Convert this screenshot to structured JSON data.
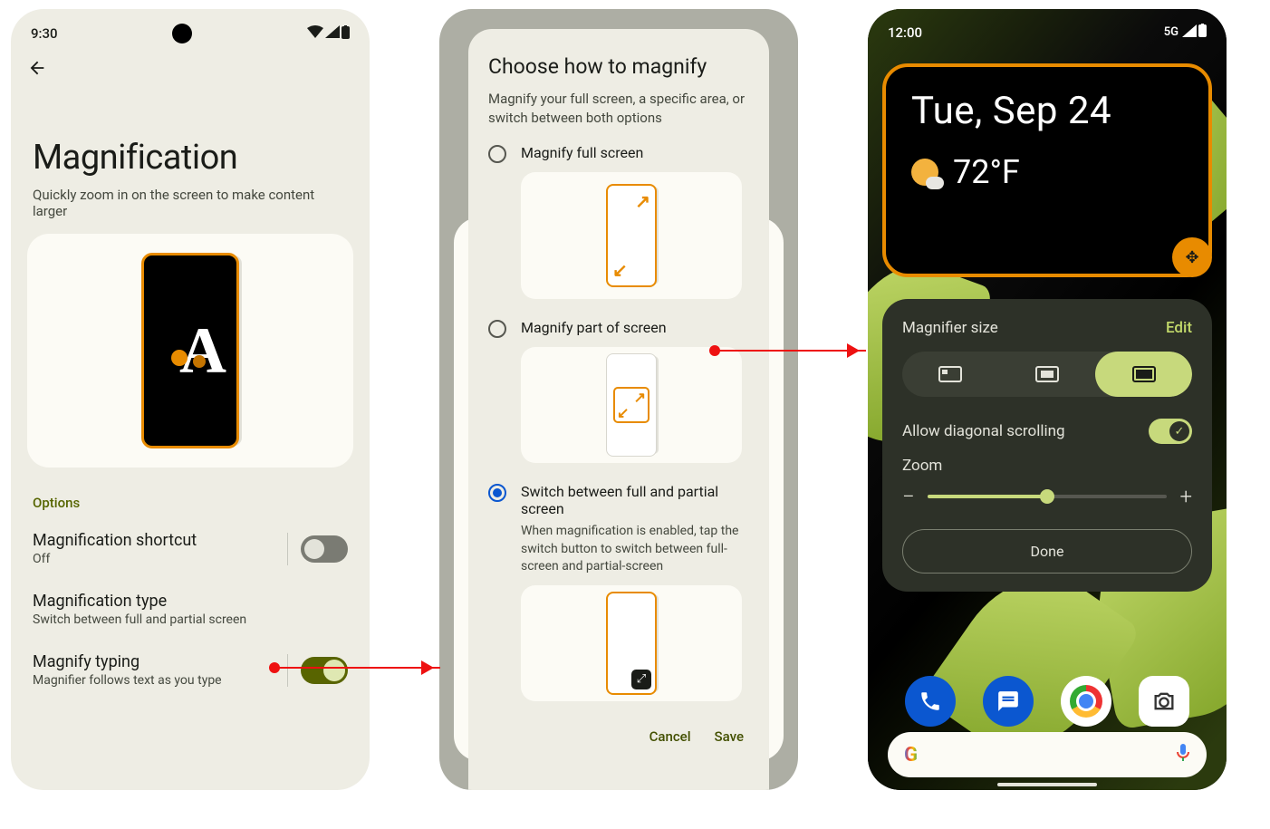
{
  "p1": {
    "status_time": "9:30",
    "title": "Magnification",
    "subtitle": "Quickly zoom in on the screen to make content larger",
    "section": "Options",
    "opts": [
      {
        "t": "Magnification shortcut",
        "s": "Off",
        "toggle": false,
        "has_toggle": true
      },
      {
        "t": "Magnification type",
        "s": "Switch between full and partial screen",
        "has_toggle": false
      },
      {
        "t": "Magnify typing",
        "s": "Magnifier follows text as you type",
        "toggle": true,
        "has_toggle": true
      }
    ]
  },
  "p2": {
    "title": "Choose how to magnify",
    "desc": "Magnify your full screen, a specific area, or switch between both options",
    "choices": [
      {
        "label": "Magnify full screen",
        "selected": false
      },
      {
        "label": "Magnify part of screen",
        "selected": false
      },
      {
        "label": "Switch between full and partial screen",
        "selected": true,
        "desc": "When magnification is enabled, tap the switch button to switch between full-screen and partial-screen"
      }
    ],
    "cancel": "Cancel",
    "save": "Save"
  },
  "p3": {
    "status_time": "12:00",
    "net": "5G",
    "date": "Tue, Sep 24",
    "temp": "72°F",
    "panel_title": "Magnifier size",
    "edit": "Edit",
    "diag": "Allow diagonal scrolling",
    "zoom": "Zoom",
    "done": "Done"
  }
}
